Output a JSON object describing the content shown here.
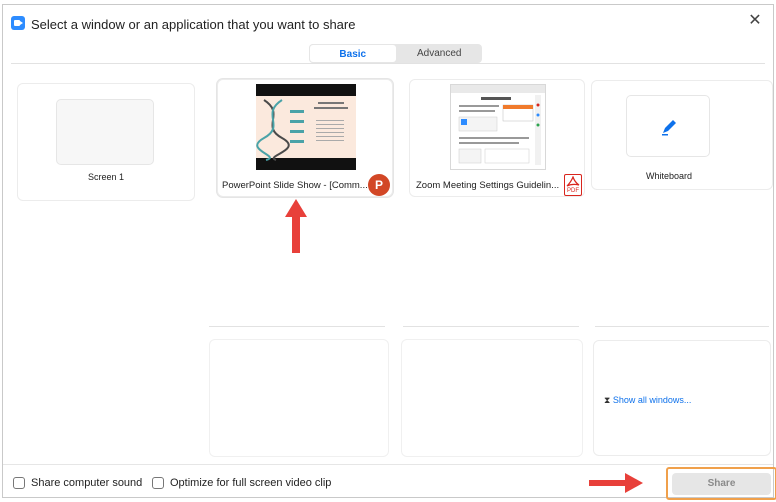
{
  "window": {
    "title": "Select a window or an application that you want to share",
    "close_glyph": "✕"
  },
  "tabs": [
    {
      "label": "Basic",
      "active": true
    },
    {
      "label": "Advanced",
      "active": false
    }
  ],
  "items": [
    {
      "label": "Screen 1",
      "kind": "screen"
    },
    {
      "label": "PowerPoint Slide Show - [Comm...",
      "kind": "app",
      "badge_icon": "powerpoint-icon",
      "badge_text": "P"
    },
    {
      "label": "Zoom Meeting Settings Guidelin...",
      "kind": "app",
      "badge_icon": "pdf-icon",
      "badge_text": "PDF"
    },
    {
      "label": "Whiteboard",
      "kind": "whiteboard",
      "icon": "pen-icon"
    }
  ],
  "show_all": {
    "label": "Show all windows...",
    "icon": "hourglass-icon"
  },
  "footer": {
    "share_sound_label": "Share computer sound",
    "optimize_label": "Optimize for full screen video clip",
    "share_button_label": "Share"
  },
  "colors": {
    "accent": "#0e71eb",
    "annotation_arrow": "#e8403a",
    "share_highlight": "#f0a04b",
    "powerpoint": "#d24726",
    "pdf": "#d9251d"
  }
}
